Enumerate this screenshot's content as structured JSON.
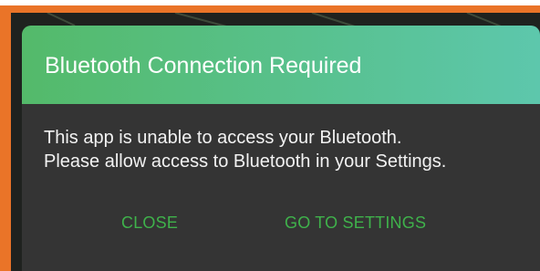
{
  "dialog": {
    "title": "Bluetooth Connection Required",
    "message_line1": "This app is unable to access your Bluetooth.",
    "message_line2": "Please allow access to Bluetooth in your Settings.",
    "close_label": "CLOSE",
    "settings_label": "GO TO SETTINGS"
  },
  "colors": {
    "frame_border": "#ea7428",
    "header_gradient_start": "#54ba6a",
    "header_gradient_end": "#5dc7ac",
    "dialog_background": "#343434",
    "action_text": "#3fb24b"
  }
}
